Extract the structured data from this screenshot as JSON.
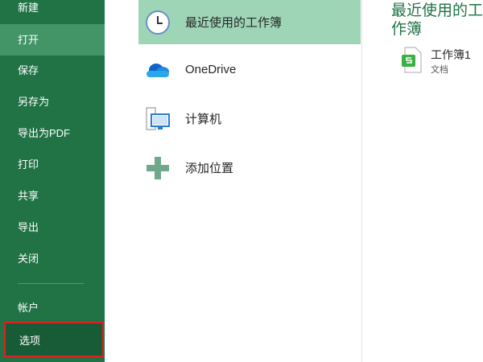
{
  "sidebar": {
    "items": [
      {
        "label": "新建"
      },
      {
        "label": "打开"
      },
      {
        "label": "保存"
      },
      {
        "label": "另存为"
      },
      {
        "label": "导出为PDF"
      },
      {
        "label": "打印"
      },
      {
        "label": "共享"
      },
      {
        "label": "导出"
      },
      {
        "label": "关闭"
      },
      {
        "label": "帐户"
      },
      {
        "label": "选项"
      }
    ]
  },
  "places": [
    {
      "label": "最近使用的工作簿",
      "icon": "clock-icon"
    },
    {
      "label": "OneDrive",
      "icon": "cloud-icon"
    },
    {
      "label": "计算机",
      "icon": "computer-icon"
    },
    {
      "label": "添加位置",
      "icon": "plus-icon"
    }
  ],
  "recent": {
    "title": "最近使用的工作簿",
    "files": [
      {
        "name": "工作簿1",
        "type": "文档"
      }
    ]
  },
  "colors": {
    "sidebar": "#217346",
    "selected": "#439467",
    "place_selected": "#9fd5b7",
    "highlight": "#e0201f"
  }
}
